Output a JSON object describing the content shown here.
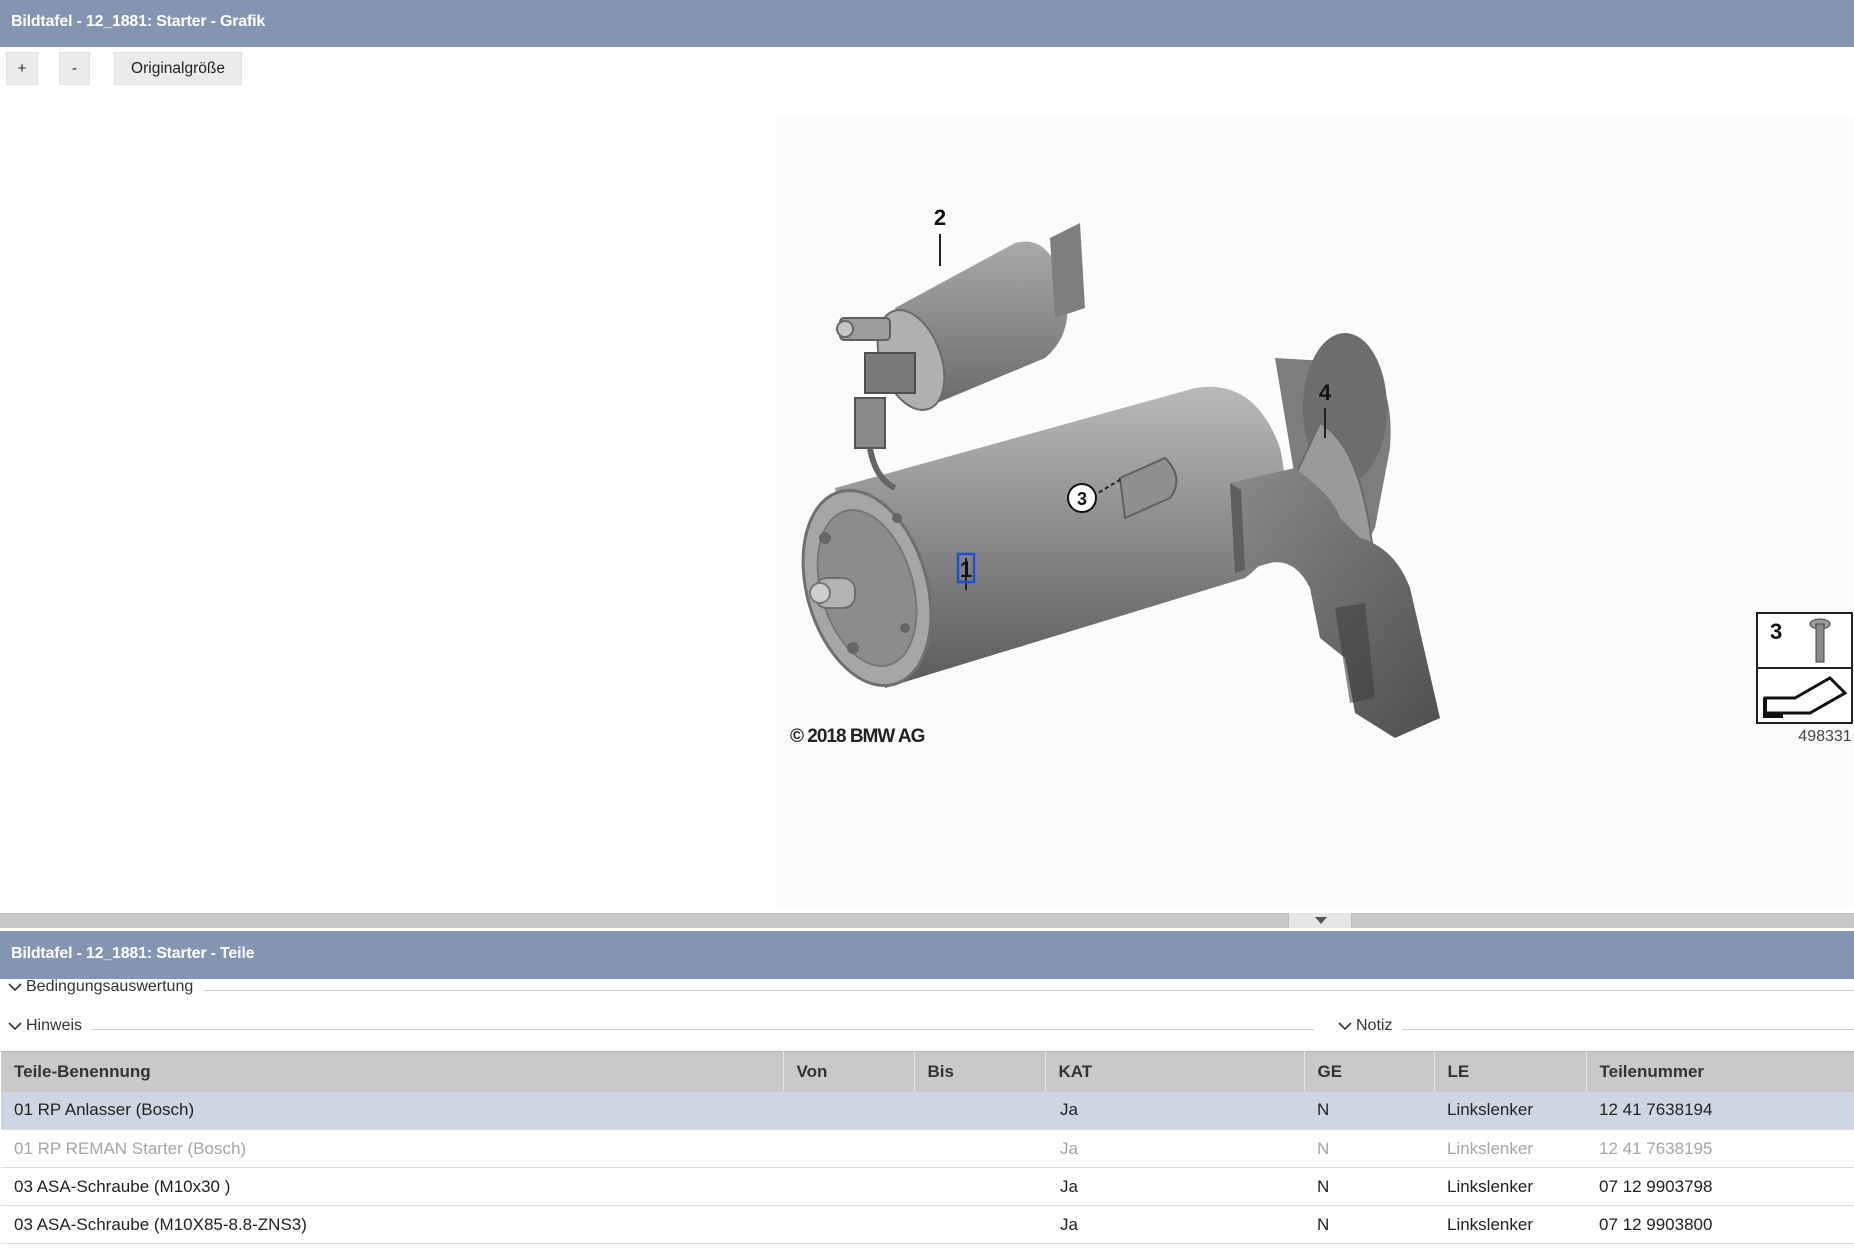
{
  "graphic_panel": {
    "title": "Bildtafel - 12_1881: Starter - Grafik",
    "toolbar": {
      "zoom_in": "+",
      "zoom_out": "-",
      "original_size": "Originalgröße"
    },
    "figure": {
      "callouts": [
        "1",
        "2",
        "3",
        "4"
      ],
      "copyright": "© 2018 BMW AG",
      "legend_number": "3",
      "image_id": "498331"
    }
  },
  "parts_panel": {
    "title": "Bildtafel - 12_1881: Starter - Teile",
    "sections": {
      "conditions": "Bedingungsauswertung",
      "note": "Hinweis",
      "memo": "Notiz"
    },
    "table": {
      "columns": [
        "Teile-Benennung",
        "Von",
        "Bis",
        "KAT",
        "GE",
        "LE",
        "Teilenummer"
      ],
      "rows": [
        {
          "name": "01 RP Anlasser (Bosch)",
          "von": "",
          "bis": "",
          "kat": "Ja",
          "ge": "N",
          "le": "Linkslenker",
          "part_no": "12 41 7638194"
        },
        {
          "name": "01 RP REMAN Starter (Bosch)",
          "von": "",
          "bis": "",
          "kat": "Ja",
          "ge": "N",
          "le": "Linkslenker",
          "part_no": "12 41 7638195"
        },
        {
          "name": "03 ASA-Schraube (M10x30 )",
          "von": "",
          "bis": "",
          "kat": "Ja",
          "ge": "N",
          "le": "Linkslenker",
          "part_no": "07 12 9903798"
        },
        {
          "name": "03 ASA-Schraube (M10X85-8.8-ZNS3)",
          "von": "",
          "bis": "",
          "kat": "Ja",
          "ge": "N",
          "le": "Linkslenker",
          "part_no": "07 12 9903800"
        }
      ]
    }
  },
  "colors": {
    "header_bg": "#8395b3",
    "selected_row": "#cdd6e2",
    "table_header_bg": "#c9c9c9",
    "callout_highlight": "#1a4fd6"
  }
}
